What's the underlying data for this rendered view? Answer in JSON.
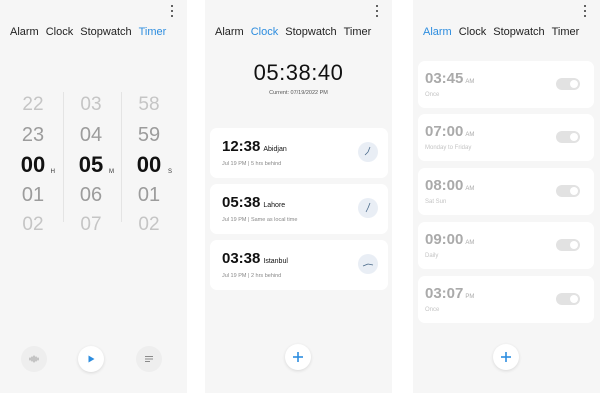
{
  "tabs": [
    "Alarm",
    "Clock",
    "Stopwatch",
    "Timer"
  ],
  "timer": {
    "hours": [
      "22",
      "23",
      "00",
      "01",
      "02"
    ],
    "minutes": [
      "03",
      "04",
      "05",
      "06",
      "07"
    ],
    "seconds": [
      "58",
      "59",
      "00",
      "01",
      "02"
    ],
    "units": {
      "hours": "H",
      "minutes": "M",
      "seconds": "S"
    }
  },
  "clock": {
    "time": "05:38:40",
    "current": "Current: 07/19/2022 PM",
    "cities": [
      {
        "time": "12:38",
        "city": "Abidjan",
        "info": "Jul 19 PM  |  5 hrs behind"
      },
      {
        "time": "05:38",
        "city": "Lahore",
        "info": "Jul 19 PM  |  Same as local time"
      },
      {
        "time": "03:38",
        "city": "Istanbul",
        "info": "Jul 19 PM  |  2 hrs behind"
      }
    ]
  },
  "alarms": [
    {
      "time": "03:45",
      "ampm": "AM",
      "repeat": "Once",
      "enabled": false
    },
    {
      "time": "07:00",
      "ampm": "AM",
      "repeat": "Monday to Friday",
      "enabled": false
    },
    {
      "time": "08:00",
      "ampm": "AM",
      "repeat": "Sat Sun",
      "enabled": false
    },
    {
      "time": "09:00",
      "ampm": "AM",
      "repeat": "Daily",
      "enabled": false
    },
    {
      "time": "03:07",
      "ampm": "PM",
      "repeat": "Once",
      "enabled": false
    }
  ],
  "icons": {
    "menu": "more-vert-icon",
    "play": "play-icon",
    "sound": "sound-wave-icon",
    "list": "list-icon",
    "add": "plus-icon",
    "dial": "analog-clock-icon"
  },
  "colors": {
    "accent": "#2d8ddf",
    "background": "#f6f6f6",
    "card": "#ffffff"
  }
}
